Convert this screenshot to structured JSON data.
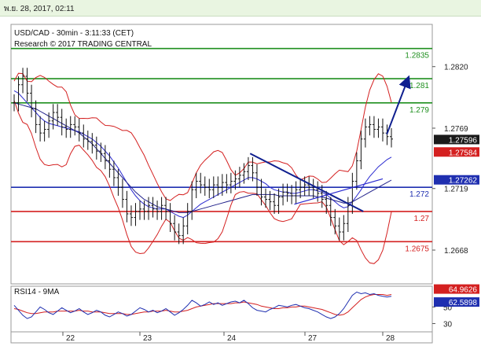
{
  "page": {
    "timestamp": "พ.ย. 28, 2017, 02:11"
  },
  "chart_data": {
    "type": "line",
    "header": {
      "symbol": "USD/CAD - 30min - 3:11:33 (CET)",
      "research": "Research © 2017 TRADING CENTRAL"
    },
    "price_axis": {
      "ylim": [
        1.264,
        1.2855
      ],
      "ticks": [
        1.282,
        1.2769,
        1.2719,
        1.2668
      ]
    },
    "x_ticks": [
      "22",
      "23",
      "24",
      "27",
      "28"
    ],
    "levels": [
      {
        "value": 1.2835,
        "label": "1.2835",
        "color": "#1f8f1f"
      },
      {
        "value": 1.281,
        "label": "1.281",
        "color": "#1f8f1f"
      },
      {
        "value": 1.279,
        "label": "1.279",
        "color": "#1f8f1f"
      },
      {
        "value": 1.272,
        "label": "1.272",
        "color": "#1f2fb0"
      },
      {
        "value": 1.27,
        "label": "1.27",
        "color": "#d42020"
      },
      {
        "value": 1.2675,
        "label": "1.2675",
        "color": "#d42020"
      }
    ],
    "price_badges": [
      {
        "value": 1.27596,
        "label": "1.27596",
        "color": "#1a1a1a"
      },
      {
        "value": 1.27584,
        "label": "1.27584",
        "color": "#d42020"
      },
      {
        "value": 1.27262,
        "label": "1.27262",
        "color": "#1f2fb0"
      }
    ],
    "price_series": [
      1.279,
      1.2805,
      1.2812,
      1.2798,
      1.2785,
      1.2772,
      1.2765,
      1.2768,
      1.2775,
      1.2782,
      1.2778,
      1.277,
      1.2768,
      1.2772,
      1.277,
      1.2765,
      1.276,
      1.2758,
      1.2755,
      1.275,
      1.2748,
      1.2742,
      1.2735,
      1.2728,
      1.272,
      1.271,
      1.2698,
      1.2695,
      1.27,
      1.2702,
      1.27,
      1.2705,
      1.2702,
      1.27,
      1.2705,
      1.27,
      1.269,
      1.2683,
      1.268,
      1.2688,
      1.27,
      1.2718,
      1.2725,
      1.2722,
      1.272,
      1.2718,
      1.2722,
      1.272,
      1.2724,
      1.2722,
      1.2725,
      1.2727,
      1.273,
      1.2733,
      1.2738,
      1.2732,
      1.272,
      1.2712,
      1.271,
      1.2708,
      1.2705,
      1.2712,
      1.2716,
      1.2715,
      1.2713,
      1.2718,
      1.272,
      1.2722,
      1.272,
      1.2718,
      1.2715,
      1.271,
      1.2705,
      1.2695,
      1.2688,
      1.2683,
      1.269,
      1.2705,
      1.2725,
      1.2742,
      1.276,
      1.277,
      1.2772,
      1.2768,
      1.277,
      1.2765,
      1.2762,
      1.276
    ],
    "ma_fast": [
      1.28,
      1.2798,
      1.2794,
      1.279,
      1.2786,
      1.2782,
      1.2778,
      1.2775,
      1.2773,
      1.2772,
      1.2771,
      1.277,
      1.2769,
      1.2768,
      1.2767,
      1.2766,
      1.2764,
      1.2762,
      1.276,
      1.2757,
      1.2754,
      1.275,
      1.2746,
      1.2741,
      1.2736,
      1.273,
      1.2724,
      1.2718,
      1.2713,
      1.2709,
      1.2706,
      1.2704,
      1.2703,
      1.2702,
      1.2702,
      1.2702,
      1.27,
      1.2698,
      1.2696,
      1.2695,
      1.2697,
      1.27,
      1.2703,
      1.2706,
      1.2708,
      1.271,
      1.2712,
      1.2714,
      1.2716,
      1.2718,
      1.272,
      1.2722,
      1.2724,
      1.2726,
      1.2728,
      1.2728,
      1.2727,
      1.2725,
      1.2723,
      1.272,
      1.2718,
      1.2717,
      1.2716,
      1.2716,
      1.2715,
      1.2715,
      1.2716,
      1.2717,
      1.2718,
      1.2718,
      1.2717,
      1.2716,
      1.2714,
      1.2711,
      1.2708,
      1.2705,
      1.2703,
      1.2704,
      1.2708,
      1.2713,
      1.2718,
      1.2724,
      1.2729,
      1.2733,
      1.2737,
      1.274,
      1.2743,
      1.2745
    ],
    "ma_slow": [
      1.279,
      1.2789,
      1.2788,
      1.2787,
      1.2786,
      1.2785,
      1.2783,
      1.2781,
      1.2779,
      1.2777,
      1.2775,
      1.2773,
      1.2771,
      1.2769,
      1.2767,
      1.2765,
      1.2762,
      1.2759,
      1.2756,
      1.2752,
      1.2748,
      1.2744,
      1.274,
      1.2736,
      1.2732,
      1.2728,
      1.2724,
      1.272,
      1.2716,
      1.2713,
      1.271,
      1.2708,
      1.2706,
      1.2704,
      1.2703,
      1.2702,
      1.2701,
      1.27,
      1.2699,
      1.2699,
      1.2699,
      1.27,
      1.2701,
      1.2702,
      1.2703,
      1.2704,
      1.2705,
      1.2706,
      1.2707,
      1.2708,
      1.2709,
      1.271,
      1.2711,
      1.2712,
      1.2713,
      1.2714,
      1.2714,
      1.2714,
      1.2714,
      1.2714,
      1.2714,
      1.2713,
      1.2713,
      1.2713,
      1.2713,
      1.2713,
      1.2713,
      1.2713,
      1.2713,
      1.2713,
      1.2712,
      1.2712,
      1.2711,
      1.271,
      1.2709,
      1.2708,
      1.2707,
      1.2707,
      1.2708,
      1.271,
      1.2712,
      1.2714,
      1.2716,
      1.2718,
      1.272,
      1.2722,
      1.2724,
      1.2726
    ],
    "trendline_down": {
      "start": [
        24.95,
        1.2748
      ],
      "end": [
        27.75,
        1.27
      ]
    },
    "trendline_support": {
      "start": [
        26.6,
        1.2706
      ],
      "end": [
        28.0,
        1.2727
      ]
    },
    "forecast_arrow": {
      "start": [
        28.05,
        1.2764
      ],
      "end": [
        28.3,
        1.2808
      ]
    },
    "rsi": {
      "title": "RSI14 - 9MA",
      "ylim": [
        20,
        75
      ],
      "ticks": [
        50,
        30
      ],
      "badges": [
        {
          "value": 64.9626,
          "label": "64.9626",
          "color": "#d42020"
        },
        {
          "value": 62.5898,
          "label": "62.5898",
          "color": "#1f2fb0"
        }
      ],
      "rsi_values": [
        52,
        46,
        40,
        36,
        38,
        44,
        50,
        47,
        43,
        41,
        45,
        49,
        46,
        43,
        45,
        48,
        44,
        41,
        43,
        46,
        44,
        40,
        38,
        41,
        44,
        42,
        39,
        41,
        45,
        49,
        47,
        44,
        46,
        43,
        45,
        48,
        44,
        40,
        43,
        47,
        52,
        58,
        55,
        51,
        53,
        56,
        53,
        55,
        52,
        54,
        56,
        57,
        55,
        58,
        54,
        49,
        46,
        45,
        44,
        47,
        49,
        52,
        51,
        50,
        52,
        53,
        51,
        49,
        48,
        46,
        44,
        41,
        38,
        36,
        38,
        42,
        48,
        56,
        64,
        68,
        66,
        67,
        65,
        66,
        64,
        63,
        62,
        63
      ],
      "ma_values": [
        48,
        47,
        45,
        43,
        42,
        42,
        43,
        44,
        44,
        44,
        45,
        45,
        45,
        45,
        45,
        46,
        45,
        45,
        44,
        44,
        44,
        43,
        42,
        42,
        42,
        42,
        41,
        41,
        42,
        43,
        44,
        44,
        45,
        45,
        45,
        46,
        45,
        44,
        44,
        45,
        46,
        48,
        50,
        51,
        52,
        53,
        54,
        54,
        54,
        54,
        54,
        55,
        55,
        56,
        55,
        54,
        53,
        51,
        50,
        49,
        48,
        48,
        49,
        49,
        50,
        50,
        51,
        51,
        50,
        49,
        48,
        47,
        45,
        43,
        41,
        40,
        41,
        44,
        49,
        54,
        59,
        62,
        64,
        65,
        65,
        65,
        64,
        65
      ]
    }
  }
}
